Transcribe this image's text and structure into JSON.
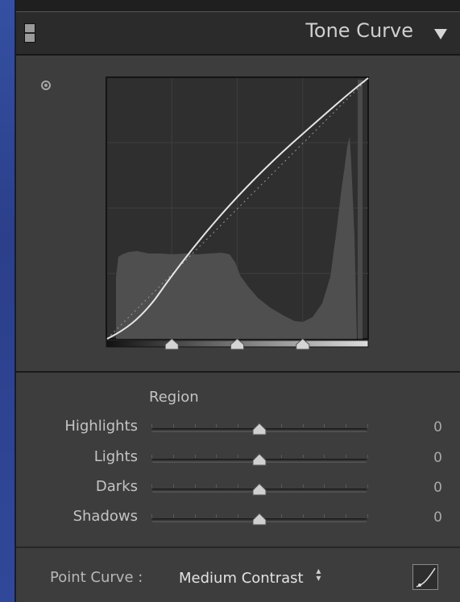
{
  "panel": {
    "title": "Tone Curve",
    "icons": {
      "toggle": "panel-toggle-icon",
      "collapse": "triangle-down-icon",
      "target": "target-adjustment-icon",
      "edit_curve": "edit-point-curve-icon"
    }
  },
  "curve": {
    "split_points": [
      0.25,
      0.5,
      0.75
    ],
    "histogram_fill": "#555555",
    "curve_color": "#e6e6e6"
  },
  "region": {
    "label": "Region",
    "sliders": [
      {
        "label": "Highlights",
        "value": "0",
        "level": 0.5
      },
      {
        "label": "Lights",
        "value": "0",
        "level": 0.5
      },
      {
        "label": "Darks",
        "value": "0",
        "level": 0.5
      },
      {
        "label": "Shadows",
        "value": "0",
        "level": 0.5
      }
    ]
  },
  "point_curve": {
    "label": "Point Curve :",
    "value": "Medium Contrast"
  },
  "colors": {
    "panel_bg": "#3d3d3d",
    "header_bg": "#2b2b2b",
    "desktop_bg": "#2a3f86"
  }
}
